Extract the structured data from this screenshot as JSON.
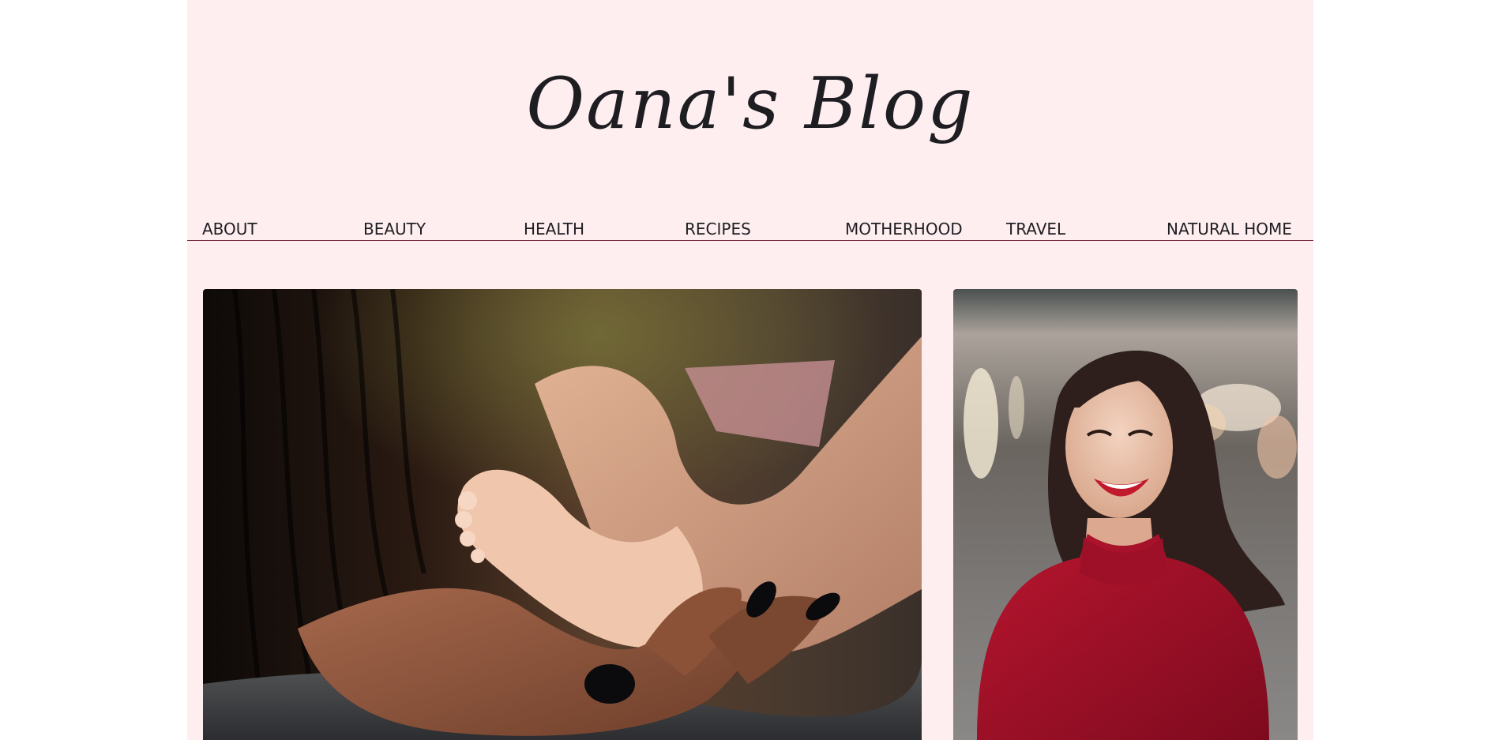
{
  "header": {
    "title": "Oana's Blog"
  },
  "nav": {
    "items": [
      {
        "label": "ABOUT"
      },
      {
        "label": "BEAUTY"
      },
      {
        "label": "HEALTH"
      },
      {
        "label": "RECIPES"
      },
      {
        "label": "MOTHERHOOD"
      },
      {
        "label": "TRAVEL"
      },
      {
        "label": "NATURAL HOME"
      }
    ]
  },
  "colors": {
    "page_background": "#ffeef0",
    "text": "#1e1e22",
    "nav_rule": "#7a2a3e",
    "sweater_red": "#a8122b"
  },
  "posts": {
    "featured_image": "baby-feet-in-hand-photo",
    "side_image": "smiling-woman-red-sweater-photo"
  }
}
